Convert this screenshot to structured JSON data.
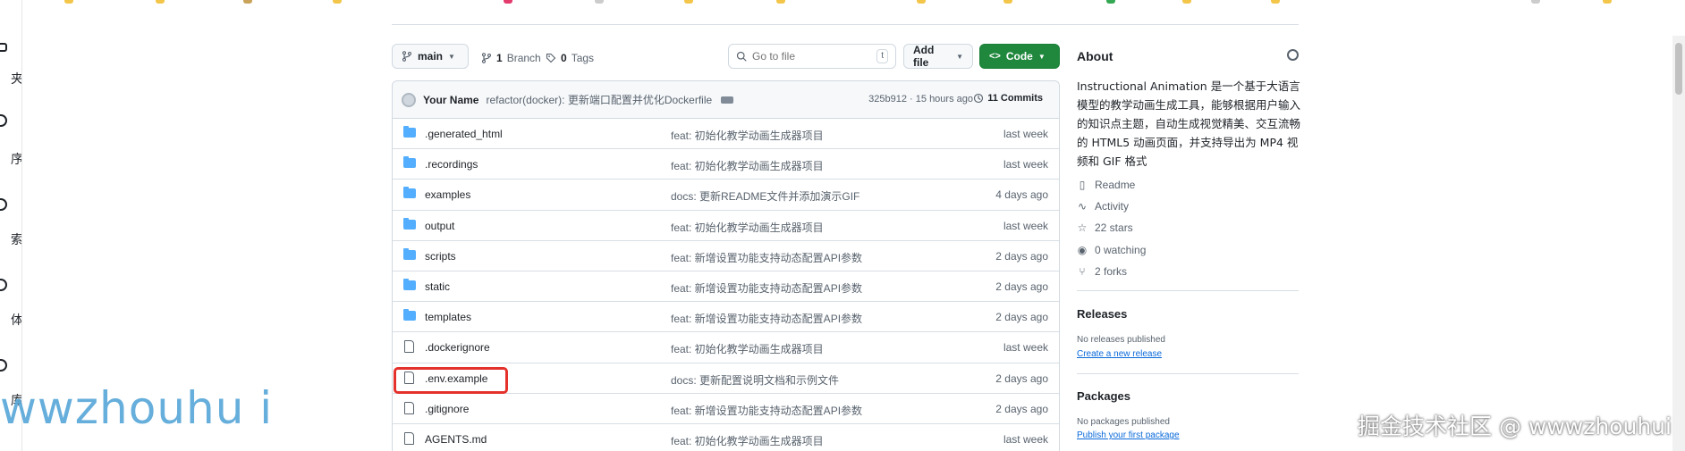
{
  "toolbar": {
    "branch_label": "main",
    "branches_count": "1",
    "branches_label": "Branch",
    "tags_count": "0",
    "tags_label": "Tags",
    "search_placeholder": "Go to file",
    "search_kbd": "t",
    "add_file_label": "Add file",
    "code_label": "Code"
  },
  "commit": {
    "author": "Your Name",
    "message": "refactor(docker): 更新端口配置并优化Dockerfile",
    "meta": "325b912 · 15 hours ago",
    "commits_label": "11 Commits"
  },
  "files": [
    {
      "name": ".generated_html",
      "type": "folder",
      "message": "feat: 初始化教学动画生成器项目",
      "date": "last week"
    },
    {
      "name": ".recordings",
      "type": "folder",
      "message": "feat: 初始化教学动画生成器项目",
      "date": "last week"
    },
    {
      "name": "examples",
      "type": "folder",
      "message": "docs: 更新README文件并添加演示GIF",
      "date": "4 days ago"
    },
    {
      "name": "output",
      "type": "folder",
      "message": "feat: 初始化教学动画生成器项目",
      "date": "last week"
    },
    {
      "name": "scripts",
      "type": "folder",
      "message": "feat: 新增设置功能支持动态配置API参数",
      "date": "2 days ago"
    },
    {
      "name": "static",
      "type": "folder",
      "message": "feat: 新增设置功能支持动态配置API参数",
      "date": "2 days ago"
    },
    {
      "name": "templates",
      "type": "folder",
      "message": "feat: 新增设置功能支持动态配置API参数",
      "date": "2 days ago"
    },
    {
      "name": ".dockerignore",
      "type": "file",
      "message": "feat: 初始化教学动画生成器项目",
      "date": "last week"
    },
    {
      "name": ".env.example",
      "type": "file",
      "message": "docs: 更新配置说明文档和示例文件",
      "date": "2 days ago"
    },
    {
      "name": ".gitignore",
      "type": "file",
      "message": "feat: 新增设置功能支持动态配置API参数",
      "date": "2 days ago"
    },
    {
      "name": "AGENTS.md",
      "type": "file",
      "message": "feat: 初始化教学动画生成器项目",
      "date": "last week"
    }
  ],
  "about": {
    "title": "About",
    "description": "Instructional Animation 是一个基于大语言模型的教学动画生成工具，能够根据用户输入的知识点主题，自动生成视觉精美、交互流畅的 HTML5 动画页面，并支持导出为 MP4 视频和 GIF 格式",
    "readme": "Readme",
    "activity": "Activity",
    "stars": "22 stars",
    "watching": "0 watching",
    "forks": "2 forks"
  },
  "releases": {
    "title": "Releases",
    "empty": "No releases published",
    "create_link": "Create a new release"
  },
  "packages": {
    "title": "Packages",
    "empty": "No packages published",
    "publish_link": "Publish your first package"
  },
  "leftbar": {
    "items": [
      "夹",
      "序",
      "索",
      "体",
      "库"
    ]
  },
  "watermark": {
    "left": "wwzhouhu i",
    "right": "掘金技术社区 @ wwwzhouhui"
  },
  "colors": {
    "code_button": "#1f883d",
    "folder": "#54aeff",
    "highlight": "#e5312b",
    "link": "#0969da"
  }
}
